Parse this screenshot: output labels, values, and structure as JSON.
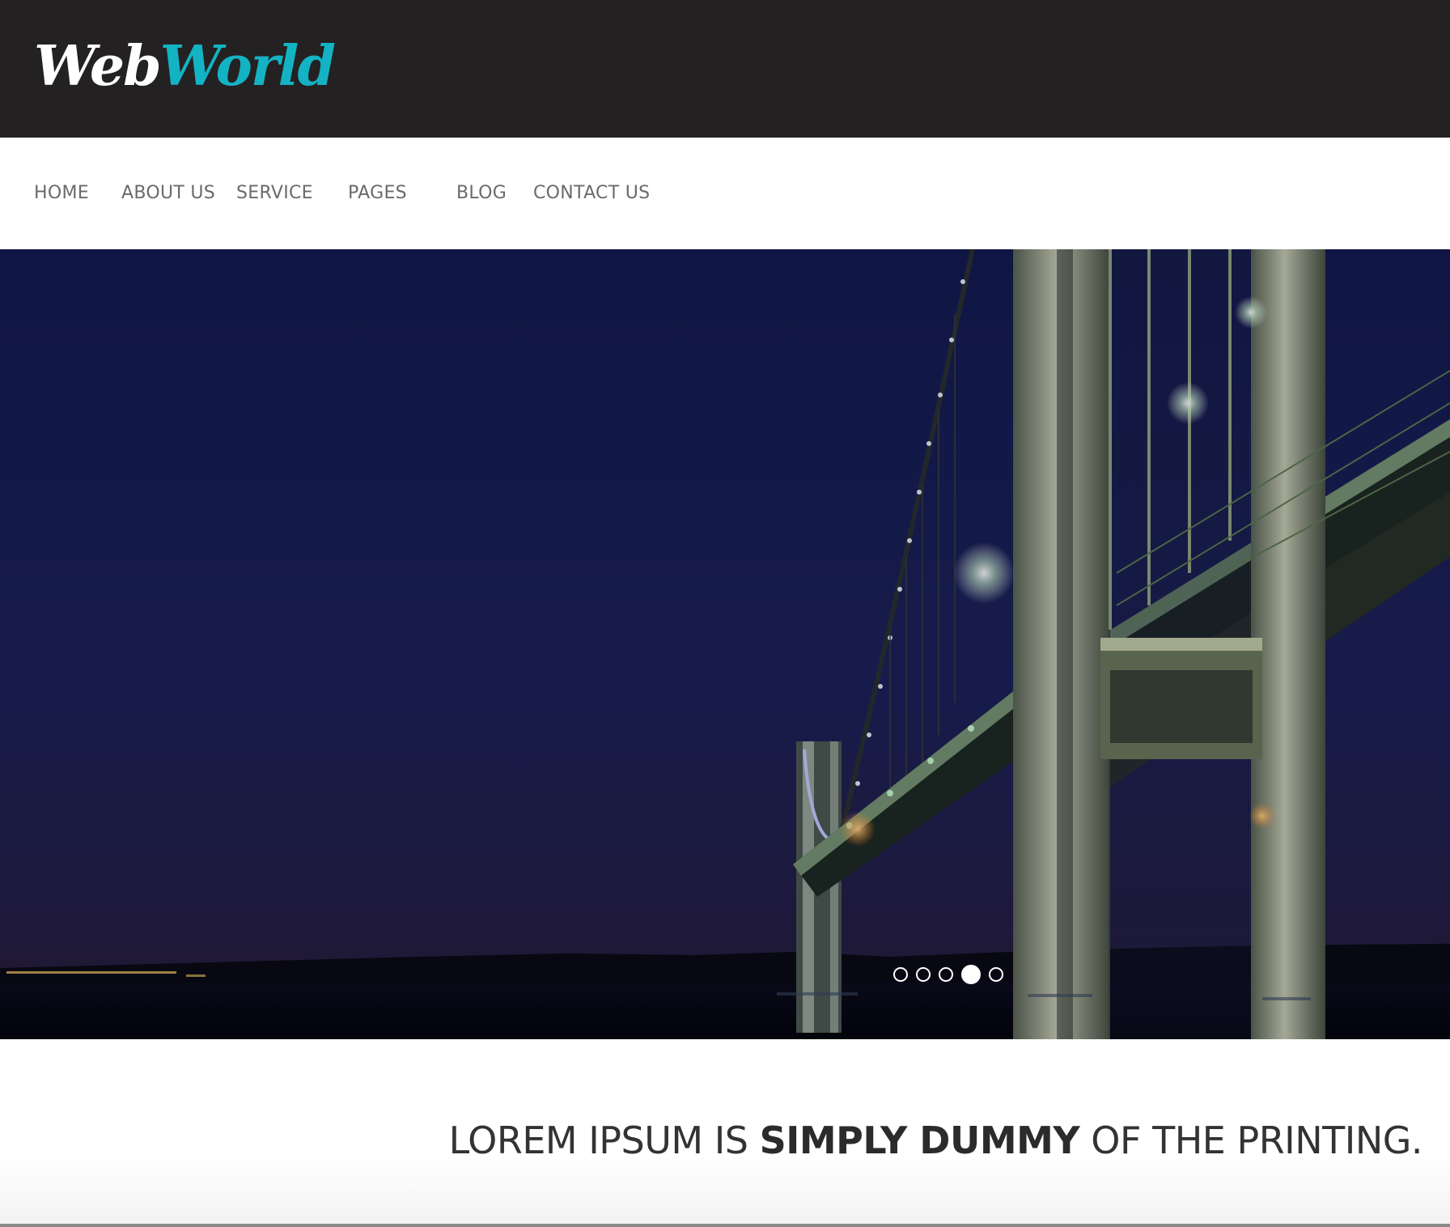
{
  "header": {
    "logo_part_a": "Web",
    "logo_part_b": "World",
    "colors": {
      "bar": "#242122",
      "logo_accent": "#13b3c4"
    }
  },
  "nav": {
    "items": [
      {
        "label": "HOME"
      },
      {
        "label": "ABOUT US"
      },
      {
        "label": "SERVICE"
      },
      {
        "label": "PAGES"
      },
      {
        "label": "BLOG"
      },
      {
        "label": "CONTACT US"
      }
    ]
  },
  "hero": {
    "image": "bridge-at-night-photo",
    "slides_total": 5,
    "active_slide": 4
  },
  "tagline": {
    "part1": "LOREM IPSUM IS ",
    "part2": "SIMPLY DUMMY",
    "part3": " OF THE PRINTING."
  }
}
